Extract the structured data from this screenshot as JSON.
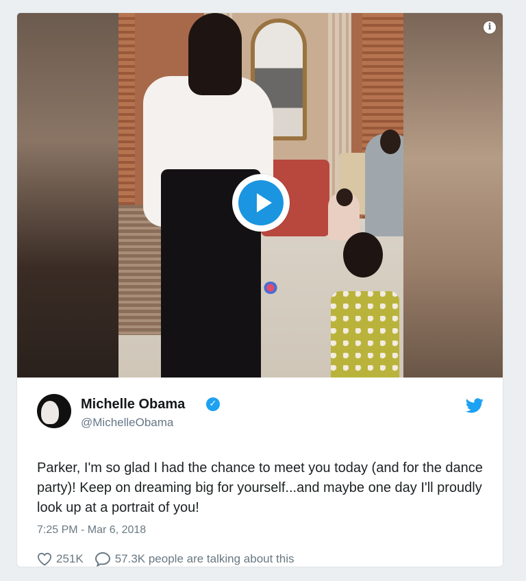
{
  "media": {
    "info_icon": "info-icon",
    "play_icon": "play-icon",
    "colors": {
      "play_button": "#1b95e0"
    }
  },
  "tweet": {
    "author_name": "Michelle Obama",
    "verified_icon": "verified-badge-icon",
    "handle": "@MichelleObama",
    "brand_icon": "twitter-bird-icon",
    "text": "Parker, I'm so glad I had the chance to meet you today (and for the dance party)!  Keep on dreaming big for yourself...and maybe one day I'll proudly look up at a portrait of you!",
    "timestamp": "7:25 PM - Mar 6, 2018",
    "like_icon": "heart-icon",
    "likes": "251K",
    "reply_icon": "speech-bubble-icon",
    "conversation": "57.3K people are talking about this",
    "colors": {
      "brand": "#1da1f2",
      "text": "#1c2022",
      "muted": "#697882"
    }
  }
}
